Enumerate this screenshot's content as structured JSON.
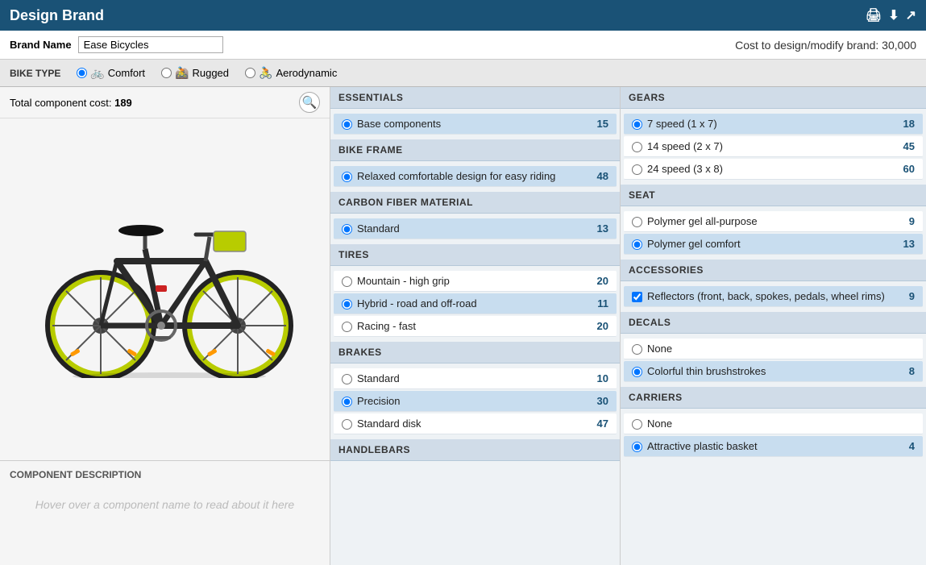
{
  "titleBar": {
    "title": "Design Brand",
    "icons": [
      "print-icon",
      "download-icon",
      "expand-icon"
    ]
  },
  "brandBar": {
    "label": "Brand Name",
    "brandName": "Ease Bicycles",
    "costText": "Cost to design/modify brand: 30,000"
  },
  "bikeTypeBar": {
    "label": "BIKE TYPE",
    "options": [
      {
        "id": "comfort",
        "label": "Comfort",
        "selected": true,
        "icon": "🚲"
      },
      {
        "id": "rugged",
        "label": "Rugged",
        "selected": false,
        "icon": "🚵"
      },
      {
        "id": "aerodynamic",
        "label": "Aerodynamic",
        "selected": false,
        "icon": "🚴"
      }
    ]
  },
  "leftPanel": {
    "totalCostLabel": "Total component cost:",
    "totalCostValue": "189",
    "componentDescTitle": "COMPONENT DESCRIPTION",
    "componentDescPlaceholder": "Hover over a component name to read about it here"
  },
  "middlePanel": {
    "sections": [
      {
        "id": "essentials",
        "header": "ESSENTIALS",
        "items": [
          {
            "id": "base-components",
            "label": "Base components",
            "cost": "15",
            "selected": true,
            "type": "radio"
          }
        ]
      },
      {
        "id": "bike-frame",
        "header": "BIKE FRAME",
        "items": [
          {
            "id": "relaxed",
            "label": "Relaxed comfortable design for easy riding",
            "cost": "48",
            "selected": true,
            "type": "radio"
          }
        ]
      },
      {
        "id": "carbon-fiber",
        "header": "CARBON FIBER MATERIAL",
        "items": [
          {
            "id": "standard-carbon",
            "label": "Standard",
            "cost": "13",
            "selected": true,
            "type": "radio"
          }
        ]
      },
      {
        "id": "tires",
        "header": "TIRES",
        "items": [
          {
            "id": "mountain",
            "label": "Mountain - high grip",
            "cost": "20",
            "selected": false,
            "type": "radio"
          },
          {
            "id": "hybrid",
            "label": "Hybrid - road and off-road",
            "cost": "11",
            "selected": true,
            "type": "radio"
          },
          {
            "id": "racing",
            "label": "Racing - fast",
            "cost": "20",
            "selected": false,
            "type": "radio"
          }
        ]
      },
      {
        "id": "brakes",
        "header": "BRAKES",
        "items": [
          {
            "id": "standard-brake",
            "label": "Standard",
            "cost": "10",
            "selected": false,
            "type": "radio"
          },
          {
            "id": "precision",
            "label": "Precision",
            "cost": "30",
            "selected": true,
            "type": "radio"
          },
          {
            "id": "standard-disk",
            "label": "Standard disk",
            "cost": "47",
            "selected": false,
            "type": "radio"
          }
        ]
      },
      {
        "id": "handlebars",
        "header": "HANDLEBARS",
        "items": []
      }
    ]
  },
  "rightPanel": {
    "sections": [
      {
        "id": "gears",
        "header": "GEARS",
        "items": [
          {
            "id": "7speed",
            "label": "7 speed (1 x 7)",
            "cost": "18",
            "selected": true,
            "type": "radio"
          },
          {
            "id": "14speed",
            "label": "14 speed (2 x 7)",
            "cost": "45",
            "selected": false,
            "type": "radio"
          },
          {
            "id": "24speed",
            "label": "24 speed (3 x 8)",
            "cost": "60",
            "selected": false,
            "type": "radio"
          }
        ]
      },
      {
        "id": "seat",
        "header": "SEAT",
        "items": [
          {
            "id": "polymer-all",
            "label": "Polymer gel all-purpose",
            "cost": "9",
            "selected": false,
            "type": "radio"
          },
          {
            "id": "polymer-comfort",
            "label": "Polymer gel comfort",
            "cost": "13",
            "selected": true,
            "type": "radio"
          }
        ]
      },
      {
        "id": "accessories",
        "header": "ACCESSORIES",
        "items": [
          {
            "id": "reflectors",
            "label": "Reflectors (front, back, spokes, pedals, wheel rims)",
            "cost": "9",
            "selected": true,
            "type": "checkbox"
          }
        ]
      },
      {
        "id": "decals",
        "header": "DECALS",
        "items": [
          {
            "id": "no-decals",
            "label": "None",
            "cost": "",
            "selected": false,
            "type": "radio"
          },
          {
            "id": "colorful-brushstrokes",
            "label": "Colorful thin brushstrokes",
            "cost": "8",
            "selected": true,
            "type": "radio"
          }
        ]
      },
      {
        "id": "carriers",
        "header": "CARRIERS",
        "items": [
          {
            "id": "no-carriers",
            "label": "None",
            "cost": "",
            "selected": false,
            "type": "radio"
          },
          {
            "id": "plastic-basket",
            "label": "Attractive plastic basket",
            "cost": "4",
            "selected": true,
            "type": "radio"
          }
        ]
      }
    ]
  }
}
